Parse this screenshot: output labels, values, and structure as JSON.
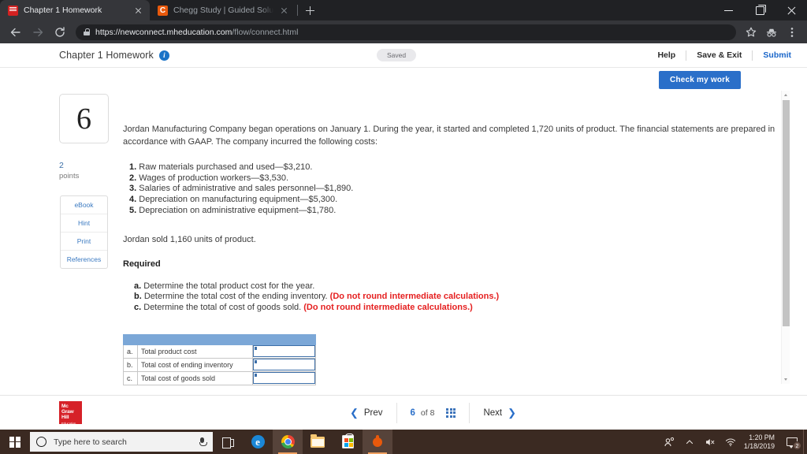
{
  "browser": {
    "tabs": [
      {
        "title": "Chapter 1 Homework",
        "favicon": "mcgraw-hill-favicon",
        "active": true
      },
      {
        "title": "Chegg Study | Guided Solutions a",
        "favicon": "chegg-favicon",
        "active": false
      }
    ],
    "new_tab_label": "+",
    "url_secure": "https://newconnect.mheducation.com",
    "url_path": "/flow/connect.html",
    "window_controls": [
      "minimize",
      "maximize",
      "close"
    ],
    "toolbar_icons": [
      "back-arrow",
      "forward-arrow",
      "reload",
      "bookmark-star",
      "incognito-guest",
      "chrome-menu"
    ]
  },
  "page": {
    "title": "Chapter 1 Homework",
    "info_icon_label": "i",
    "status_badge": "Saved",
    "actions": {
      "help": "Help",
      "save_exit": "Save & Exit",
      "submit": "Submit"
    },
    "check_my_work": "Check my work"
  },
  "question": {
    "number": "6",
    "points_value": "2",
    "points_label": "points",
    "tools": [
      "eBook",
      "Hint",
      "Print",
      "References"
    ],
    "intro": "Jordan Manufacturing Company began operations on January 1. During the year, it started and completed 1,720 units of product. The financial statements are prepared in accordance with GAAP. The company incurred the following costs:",
    "costs": [
      {
        "n": "1.",
        "text": "Raw materials purchased and used—$3,210."
      },
      {
        "n": "2.",
        "text": "Wages of production workers—$3,530."
      },
      {
        "n": "3.",
        "text": "Salaries of administrative and sales personnel—$1,890."
      },
      {
        "n": "4.",
        "text": "Depreciation on manufacturing equipment—$5,300."
      },
      {
        "n": "5.",
        "text": "Depreciation on administrative equipment—$1,780."
      }
    ],
    "sold_line": "Jordan sold 1,160 units of product.",
    "required_heading": "Required",
    "requirements": [
      {
        "letter": "a.",
        "text": "Determine the total product cost for the year.",
        "note": ""
      },
      {
        "letter": "b.",
        "text": "Determine the total cost of the ending inventory.",
        "note": "(Do not round intermediate calculations.)"
      },
      {
        "letter": "c.",
        "text": "Determine the total of cost of goods sold.",
        "note": "(Do not round intermediate calculations.)"
      }
    ]
  },
  "answer_table": {
    "header": [
      "",
      "",
      ""
    ],
    "rows": [
      {
        "letter": "a.",
        "label": "Total product cost",
        "value": ""
      },
      {
        "letter": "b.",
        "label": "Total cost of ending inventory",
        "value": ""
      },
      {
        "letter": "c.",
        "label": "Total cost of goods sold",
        "value": ""
      }
    ]
  },
  "bottom_nav": {
    "logo": {
      "l1": "Mc",
      "l2": "Graw",
      "l3": "Hill",
      "l4": "Education"
    },
    "prev": "Prev",
    "page_current": "6",
    "page_of": "of 8",
    "next": "Next",
    "grid_icon": "question-grid-icon"
  },
  "taskbar": {
    "search_placeholder": "Type here to search",
    "apps": [
      "task-view",
      "microsoft-edge",
      "google-chrome",
      "file-explorer",
      "microsoft-store",
      "orange-app"
    ],
    "tray_icons": [
      "people-share-icon",
      "show-hidden-icons-chevron",
      "volume-muted-icon",
      "wifi-icon"
    ],
    "time": "1:20 PM",
    "date": "1/18/2019",
    "notification_count": "2"
  },
  "colors": {
    "accent_blue": "#2a6fc9",
    "warn_red": "#e52020",
    "table_header_blue": "#7ba7d7",
    "brand_red": "#d62128"
  }
}
